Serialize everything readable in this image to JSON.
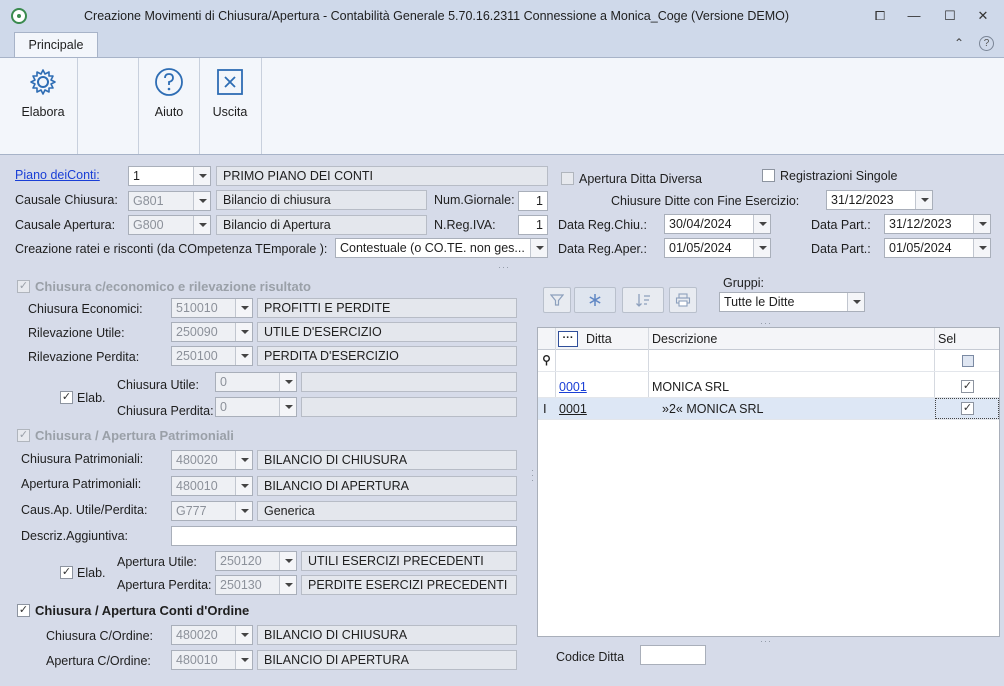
{
  "window": {
    "title": "Creazione Movimenti di Chiusura/Apertura - Contabilità Generale 5.70.16.2311  Connessione a Monica_Coge (Versione DEMO)"
  },
  "ribbon": {
    "tab": "Principale",
    "buttons": {
      "elabora": "Elabora",
      "aiuto": "Aiuto",
      "uscita": "Uscita"
    }
  },
  "top": {
    "piano_label": "Piano deiConti:",
    "piano_value": "1",
    "piano_desc": "PRIMO PIANO DEI CONTI",
    "causale_chiusura_label": "Causale Chiusura:",
    "causale_chiusura_value": "G801",
    "causale_chiusura_desc": "Bilancio di chiusura",
    "num_giornale_label": "Num.Giornale:",
    "num_giornale_value": "1",
    "causale_apertura_label": "Causale Apertura:",
    "causale_apertura_value": "G800",
    "causale_apertura_desc": "Bilancio di Apertura",
    "nreg_iva_label": "N.Reg.IVA:",
    "nreg_iva_value": "1",
    "ratei_label": "Creazione ratei e risconti (da COmpetenza TEmporale ):",
    "ratei_value": "Contestuale (o CO.TE. non ges..."
  },
  "right_top": {
    "apertura_diversa": "Apertura Ditta Diversa",
    "registrazioni_singole": "Registrazioni Singole",
    "chiusure_fine_label": "Chiusure Ditte con Fine Esercizio:",
    "chiusure_fine_value": "31/12/2023",
    "data_reg_chiu_label": "Data Reg.Chiu.:",
    "data_reg_chiu_value": "30/04/2024",
    "data_part1_label": "Data Part.:",
    "data_part1_value": "31/12/2023",
    "data_reg_aper_label": "Data Reg.Aper.:",
    "data_reg_aper_value": "01/05/2024",
    "data_part2_label": "Data Part.:",
    "data_part2_value": "01/05/2024"
  },
  "economico": {
    "title": "Chiusura c/economico e rilevazione risultato",
    "chiusura_economici_label": "Chiusura Economici:",
    "chiusura_economici_value": "510010",
    "chiusura_economici_desc": "PROFITTI E PERDITE",
    "rilevazione_utile_label": "Rilevazione Utile:",
    "rilevazione_utile_value": "250090",
    "rilevazione_utile_desc": "UTILE D'ESERCIZIO",
    "rilevazione_perdita_label": "Rilevazione Perdita:",
    "rilevazione_perdita_value": "250100",
    "rilevazione_perdita_desc": "PERDITA D'ESERCIZIO",
    "elab_label": "Elab.",
    "chiusura_utile_label": "Chiusura Utile:",
    "chiusura_utile_value": "0",
    "chiusura_perdita_label": "Chiusura Perdita:",
    "chiusura_perdita_value": "0"
  },
  "patrimoniali": {
    "title": "Chiusura / Apertura Patrimoniali",
    "chiusura_label": "Chiusura Patrimoniali:",
    "chiusura_value": "480020",
    "chiusura_desc": "BILANCIO DI CHIUSURA",
    "apertura_label": "Apertura Patrimoniali:",
    "apertura_value": "480010",
    "apertura_desc": "BILANCIO DI APERTURA",
    "caus_label": "Caus.Ap. Utile/Perdita:",
    "caus_value": "G777",
    "caus_desc": "Generica",
    "descriz_label": "Descriz.Aggiuntiva:",
    "elab_label": "Elab.",
    "apertura_utile_label": "Apertura Utile:",
    "apertura_utile_value": "250120",
    "apertura_utile_desc": "UTILI ESERCIZI PRECEDENTI",
    "apertura_perdita_label": "Apertura Perdita:",
    "apertura_perdita_value": "250130",
    "apertura_perdita_desc": "PERDITE ESERCIZI PRECEDENTI"
  },
  "ordine": {
    "title": "Chiusura / Apertura Conti d'Ordine",
    "chiusura_label": "Chiusura C/Ordine:",
    "chiusura_value": "480020",
    "chiusura_desc": "BILANCIO DI CHIUSURA",
    "apertura_label": "Apertura C/Ordine:",
    "apertura_value": "480010",
    "apertura_desc": "BILANCIO DI APERTURA"
  },
  "grid": {
    "gruppi_label": "Gruppi:",
    "gruppi_value": "Tutte le Ditte",
    "columns": {
      "ditta": "Ditta",
      "descrizione": "Descrizione",
      "sel": "Sel"
    },
    "more_glyph": "···",
    "rows": [
      {
        "ditta": "0001",
        "descrizione": "MONICA SRL",
        "sel": "✓"
      },
      {
        "ditta": "0001",
        "descrizione": "»2« MONICA SRL",
        "sel": "✓"
      }
    ],
    "codice_ditta_label": "Codice Ditta"
  },
  "glyphs": {
    "check": "✓",
    "restore": "⧠",
    "minimize": "—",
    "maximize": "☐",
    "close": "✕",
    "collapse": "⌃",
    "help": "?"
  },
  "icons": [
    "settings-gear-icon",
    "help-circle-icon",
    "exit-box-icon",
    "filter-icon",
    "snowflake-icon",
    "sort-icon",
    "print-icon",
    "pin-icon"
  ]
}
